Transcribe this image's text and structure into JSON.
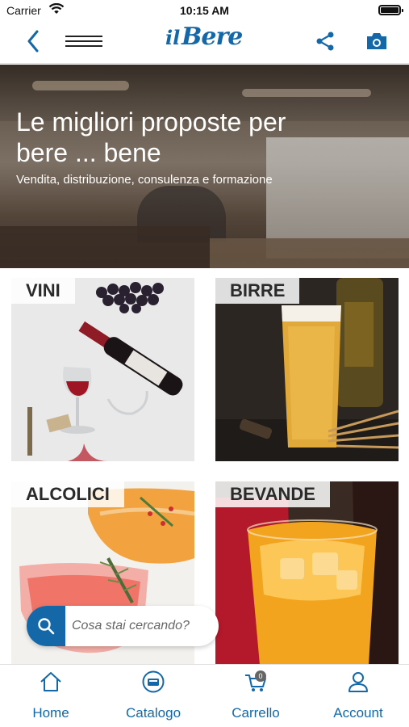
{
  "status_bar": {
    "carrier": "Carrier",
    "time": "10:15 AM"
  },
  "nav": {
    "logo_prefix": "il",
    "logo_name": "Bere",
    "icons": [
      "back-icon",
      "menu-icon",
      "share-icon",
      "camera-icon"
    ]
  },
  "hero": {
    "title": "Le migliori proposte per bere ... bene",
    "subtitle": "Vendita, distribuzione, consulenza e formazione"
  },
  "categories": [
    {
      "label": "VINI"
    },
    {
      "label": "BIRRE"
    },
    {
      "label": "ALCOLICI"
    },
    {
      "label": "BEVANDE"
    }
  ],
  "search": {
    "placeholder": "Cosa stai cercando?"
  },
  "tabs": [
    {
      "label": "Home",
      "icon": "home-icon"
    },
    {
      "label": "Catalogo",
      "icon": "catalog-icon"
    },
    {
      "label": "Carrello",
      "icon": "cart-icon",
      "badge": "0"
    },
    {
      "label": "Account",
      "icon": "user-icon"
    }
  ],
  "colors": {
    "accent": "#1468a8"
  }
}
